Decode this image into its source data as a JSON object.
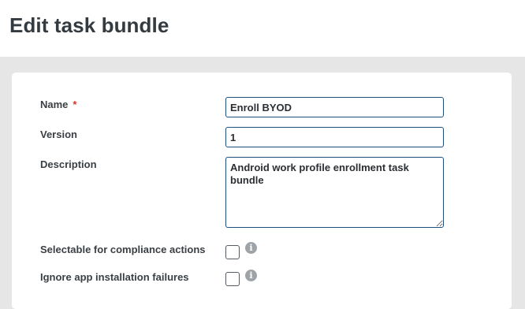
{
  "header": {
    "title": "Edit task bundle"
  },
  "form": {
    "name": {
      "label": "Name",
      "required_mark": "*",
      "value": "Enroll BYOD"
    },
    "version": {
      "label": "Version",
      "value": "1"
    },
    "description": {
      "label": "Description",
      "value": "Android work profile enrollment task bundle"
    },
    "selectable_compliance": {
      "label": "Selectable for compliance actions",
      "checked": false,
      "info_icon": "info-icon"
    },
    "ignore_app_failures": {
      "label": "Ignore app installation failures",
      "checked": false,
      "info_icon": "info-icon"
    }
  },
  "colors": {
    "page_background": "#e6e6e6",
    "card_background": "#ffffff",
    "input_border": "#1f4e79",
    "required": "#d9342b",
    "info_icon": "#9ea3a8"
  }
}
